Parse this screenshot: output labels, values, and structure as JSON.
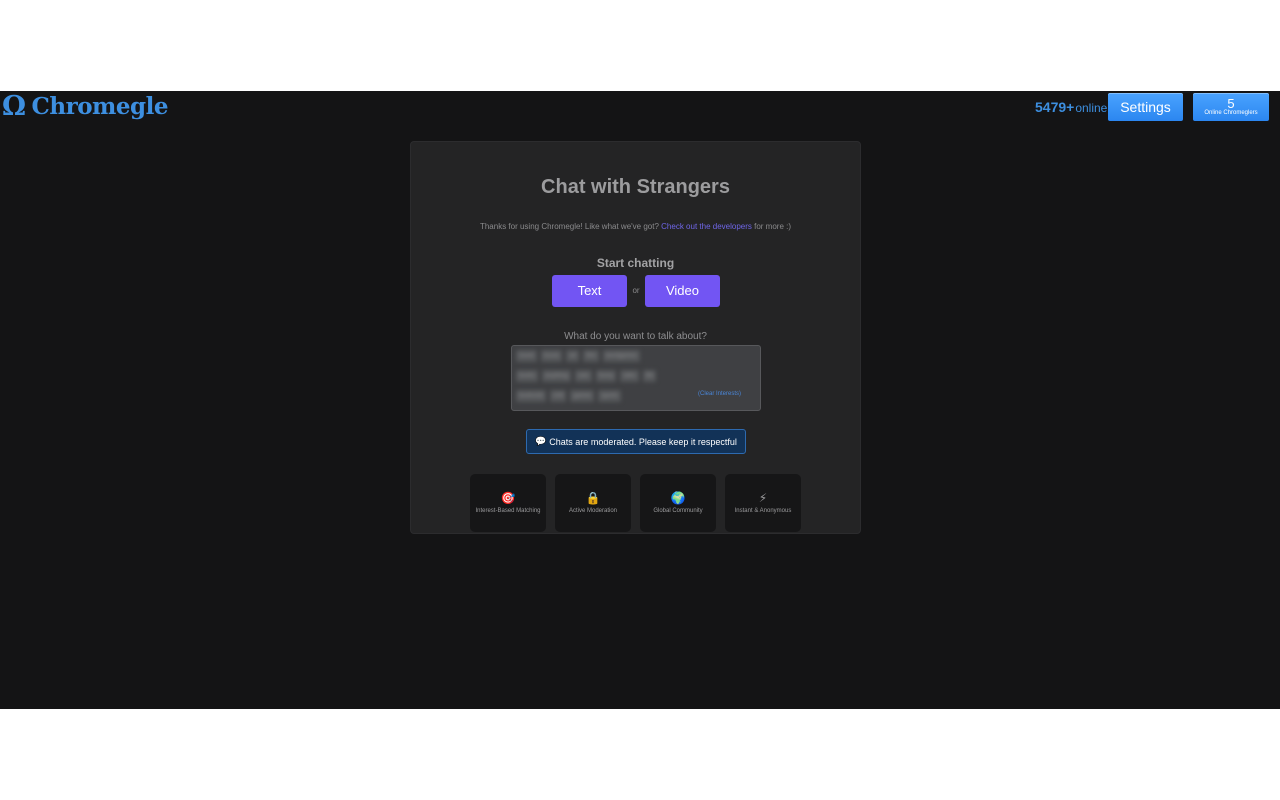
{
  "header": {
    "logo_symbol": "Ω",
    "logo_text": "Chromegle",
    "online_count": "5479+",
    "online_label": "online",
    "settings_label": "Settings",
    "chromeglers_count": "5",
    "chromeglers_label": "Online Chromeglers"
  },
  "card": {
    "title": "Chat with Strangers",
    "thanks_prefix": "Thanks for using Chromegle! Like what we've got?",
    "thanks_link": "Check out the developers",
    "thanks_suffix": "for more :)",
    "start_label": "Start chatting",
    "text_button": "Text",
    "or_label": "or",
    "video_button": "Video",
    "interests_label": "What do you want to talk about?",
    "interest_rows": [
      [
        "travel",
        "music",
        "art",
        "film",
        "wordgames"
      ],
      [
        "books",
        "anything",
        "cats",
        "funny",
        "talks",
        "life"
      ],
      [
        "bookclub",
        "chill",
        "games",
        "sports"
      ]
    ],
    "clear_interests": "(Clear Interests)",
    "notice_icon": "speech-bubble-icon",
    "notice_text": "Chats are moderated. Please keep it respectful",
    "features": [
      {
        "icon": "🎯",
        "icon_name": "target-icon",
        "label": "Interest-Based Matching"
      },
      {
        "icon": "🔒",
        "icon_name": "lock-icon",
        "label": "Active Moderation"
      },
      {
        "icon": "🌍",
        "icon_name": "globe-icon",
        "label": "Global Community"
      },
      {
        "icon": "⚡",
        "icon_name": "lightning-icon",
        "label": "Instant & Anonymous"
      }
    ]
  },
  "colors": {
    "accent_blue": "#3d8fe0",
    "button_purple": "#7255f3",
    "background": "#141415",
    "card": "#242425"
  }
}
